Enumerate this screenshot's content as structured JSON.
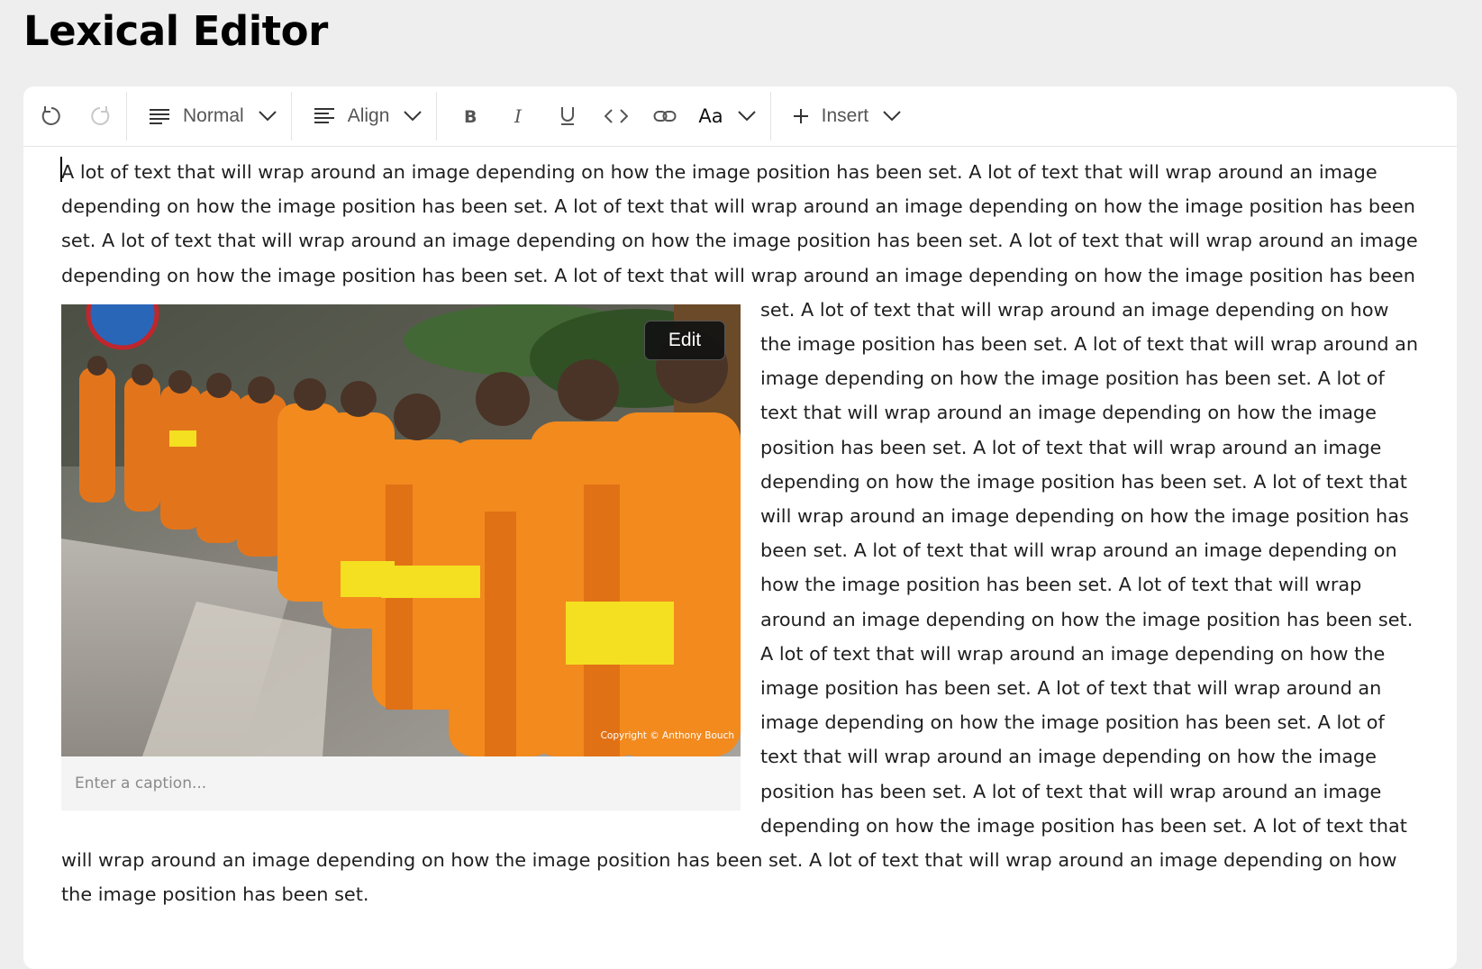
{
  "page": {
    "title": "Lexical Editor"
  },
  "toolbar": {
    "undo_icon": "undo-icon",
    "redo_icon": "redo-icon",
    "block_type_label": "Normal",
    "align_label": "Align",
    "format_buttons": [
      "bold-icon",
      "italic-icon",
      "underline-icon",
      "code-icon",
      "link-icon"
    ],
    "font_label": "Aa",
    "insert_label": "Insert"
  },
  "editor": {
    "paragraph_text": "A lot of text that will wrap around an image depending on how the image position has been set. A lot of text that will wrap around an image depending on how the image position has been set. A lot of text that will wrap around an image depending on how the image position has been set. A lot of text that will wrap around an image depending on how the image position has been set. A lot of text that will wrap around an image depending on how the image position has been set. A lot of text that will wrap around an image depending on how the image position has been set. A lot of text that will wrap around an image depending on how the image position has been set. A lot of text that will wrap around an image depending on how the image position has been set. A lot of text that will wrap around an image depending on how the image position has been set. A lot of text that will wrap around an image depending on how the image position has been set. A lot of text that will wrap around an image depending on how the image position has been set. A lot of text that will wrap around an image depending on how the image position has been set. A lot of text that will wrap around an image depending on how the image position has been set. A lot of text that will wrap around an image depending on how the image position has been set. A lot of text that will wrap around an image depending on how the image position has been set. A lot of text that will wrap around an image depending on how the image position has been set. A lot of text that will wrap around an image depending on how the image position has been set. A lot of text that will wrap around an image depending on how the image position has been set. A lot of text that will wrap around an image depending on how the image position has been set.",
    "image": {
      "edit_label": "Edit",
      "copyright": "Copyright © Anthony Bouch",
      "caption_placeholder": "Enter a caption..."
    }
  }
}
